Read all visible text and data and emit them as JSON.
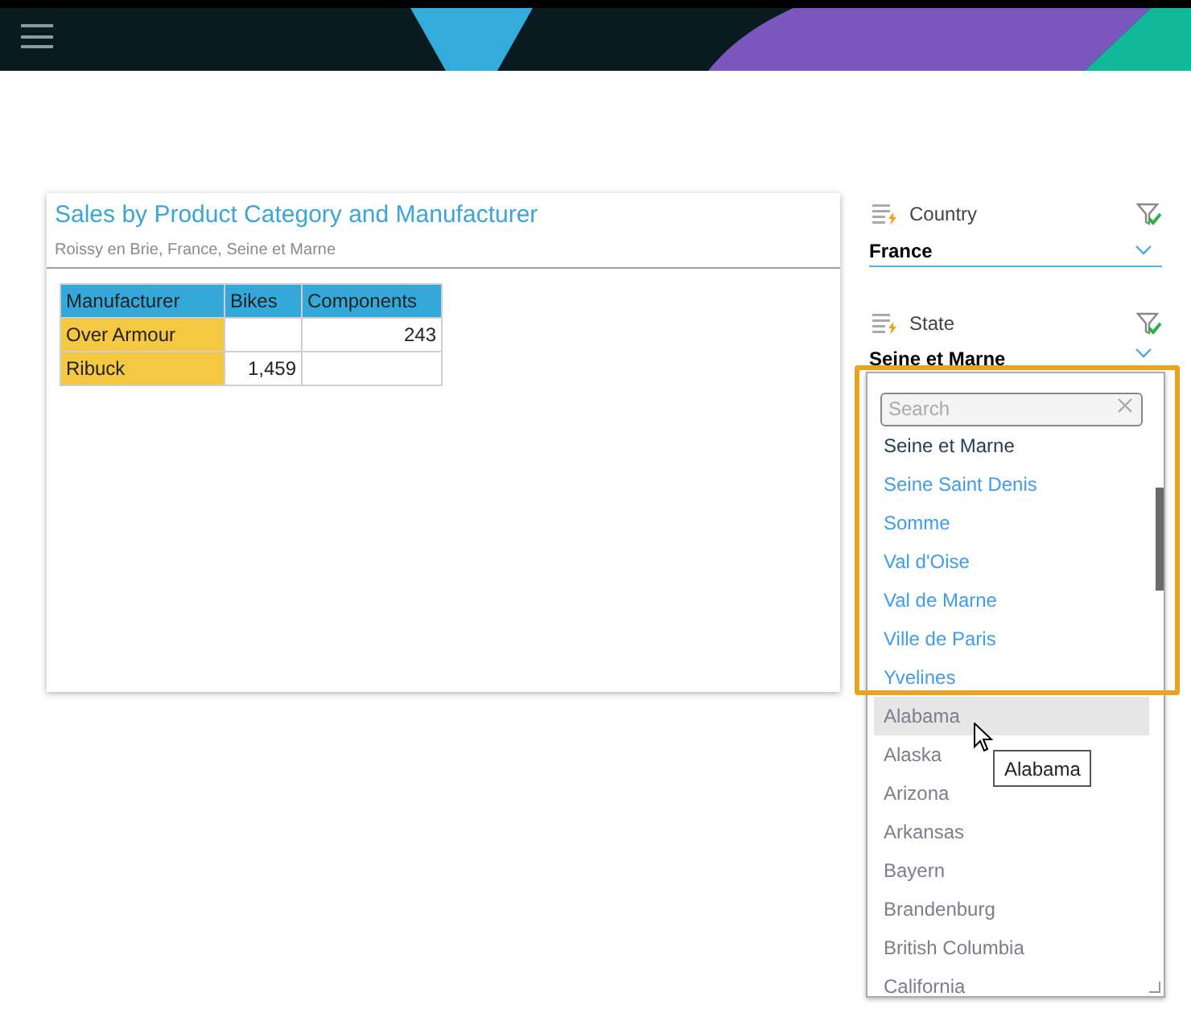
{
  "report": {
    "title": "Sales by Product Category and Manufacturer",
    "subtitle": "Roissy en Brie, France, Seine et Marne",
    "table": {
      "columns": [
        "Manufacturer",
        "Bikes",
        "Components"
      ],
      "rows": [
        [
          "Over Armour",
          "",
          "243"
        ],
        [
          "Ribuck",
          "1,459",
          ""
        ]
      ]
    }
  },
  "filters": [
    {
      "label": "Country",
      "value": "France",
      "open": false
    },
    {
      "label": "State",
      "value": "Seine et Marne",
      "open": true
    }
  ],
  "dropdown": {
    "search_placeholder": "Search",
    "items": [
      {
        "label": "Seine et Marne",
        "selected": true,
        "available": true,
        "hovered": false
      },
      {
        "label": "Seine Saint Denis",
        "selected": false,
        "available": true,
        "hovered": false
      },
      {
        "label": "Somme",
        "selected": false,
        "available": true,
        "hovered": false
      },
      {
        "label": "Val d'Oise",
        "selected": false,
        "available": true,
        "hovered": false
      },
      {
        "label": "Val de Marne",
        "selected": false,
        "available": true,
        "hovered": false
      },
      {
        "label": "Ville de Paris",
        "selected": false,
        "available": true,
        "hovered": false
      },
      {
        "label": "Yvelines",
        "selected": false,
        "available": true,
        "hovered": false
      },
      {
        "label": "Alabama",
        "selected": false,
        "available": false,
        "hovered": true
      },
      {
        "label": "Alaska",
        "selected": false,
        "available": false,
        "hovered": false
      },
      {
        "label": "Arizona",
        "selected": false,
        "available": false,
        "hovered": false
      },
      {
        "label": "Arkansas",
        "selected": false,
        "available": false,
        "hovered": false
      },
      {
        "label": "Bayern",
        "selected": false,
        "available": false,
        "hovered": false
      },
      {
        "label": "Brandenburg",
        "selected": false,
        "available": false,
        "hovered": false
      },
      {
        "label": "British Columbia",
        "selected": false,
        "available": false,
        "hovered": false
      },
      {
        "label": "California",
        "selected": false,
        "available": false,
        "hovered": false
      }
    ],
    "tooltip": "Alabama"
  }
}
